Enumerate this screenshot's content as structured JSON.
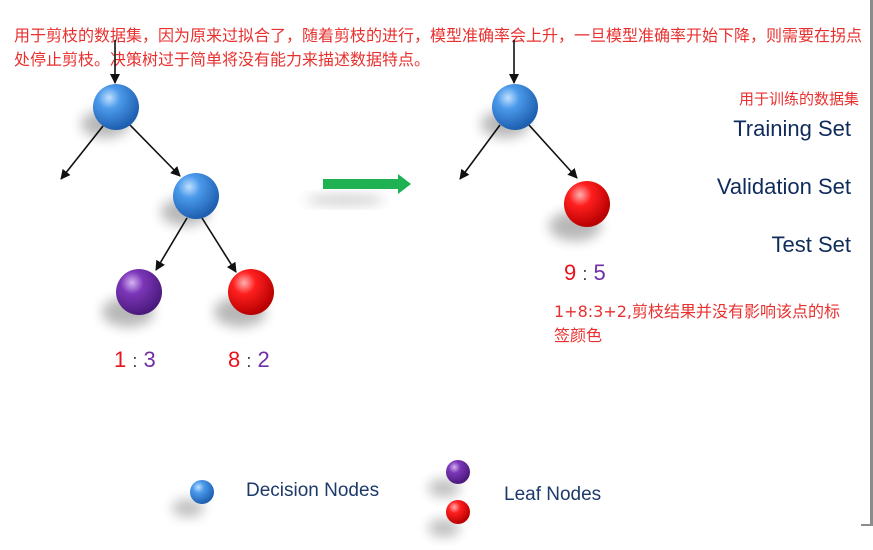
{
  "intro_text": "用于剪枝的数据集，因为原来过拟合了，随着剪枝的进行，模型准确率会上升，一旦模型准确率开始下降，则需要在拐点处停止剪枝。决策树过于简单将没有能力来描述数据特点。",
  "sets": {
    "note": "用于训练的数据集",
    "training": "Training Set",
    "validation": "Validation Set",
    "test": "Test Set"
  },
  "before_tree": {
    "leaf_left_ratio": {
      "red": "1",
      "sep": ":",
      "purple": "3"
    },
    "leaf_right_ratio": {
      "red": "8",
      "sep": ":",
      "purple": "2"
    }
  },
  "after_tree": {
    "leaf_ratio": {
      "red": "9",
      "sep": ":",
      "purple": "5"
    }
  },
  "pruning_note": "1+8:3+2,剪枝结果并没有影响该点的标签颜色",
  "legend": {
    "decision": "Decision Nodes",
    "leaf": "Leaf Nodes"
  },
  "colors": {
    "decision_node": "#2f7fd9",
    "leaf_red": "#f00d0d",
    "leaf_purple": "#6f2fa6",
    "arrow_green": "#1fb152",
    "annotation_red": "#e8312f",
    "label_navy": "#0f2b5b"
  }
}
